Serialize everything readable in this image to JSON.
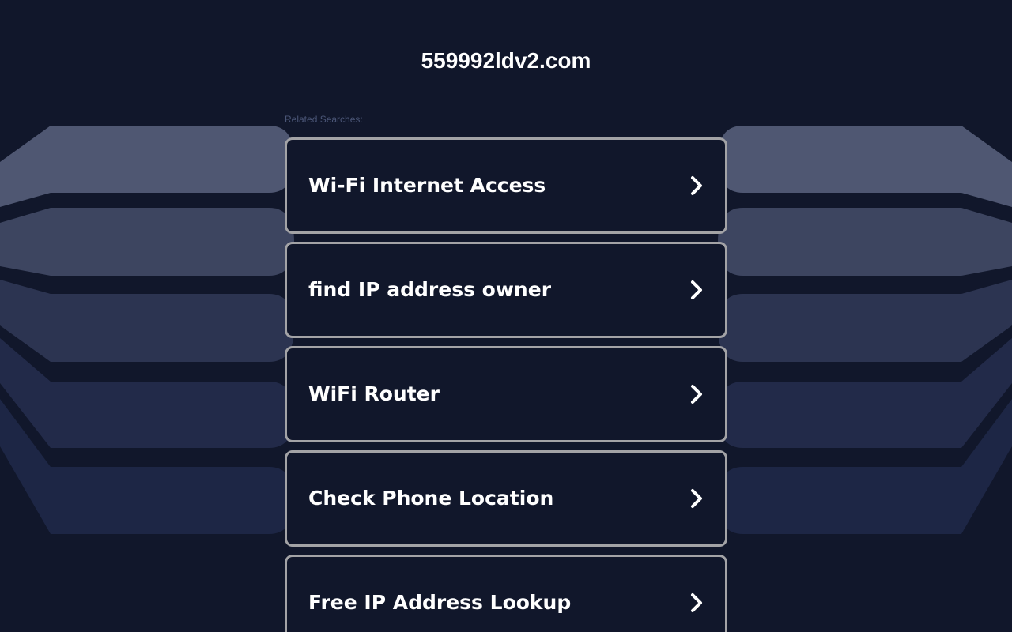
{
  "header": {
    "site_title": "559992ldv2.com"
  },
  "related": {
    "label": "Related Searches:",
    "items": [
      {
        "label": "Wi-Fi Internet Access",
        "icon": "chevron-right-icon"
      },
      {
        "label": "find IP address owner",
        "icon": "chevron-right-icon"
      },
      {
        "label": "WiFi Router",
        "icon": "chevron-right-icon"
      },
      {
        "label": "Check Phone Location",
        "icon": "chevron-right-icon"
      },
      {
        "label": "Free IP Address Lookup",
        "icon": "chevron-right-icon"
      }
    ]
  },
  "colors": {
    "background": "#11172b",
    "card_border": "#a3a3a6",
    "band_1": "#4f5772",
    "band_2": "#3d4560",
    "band_3": "#2c3451",
    "band_4": "#222a49",
    "band_5": "#1d2645"
  }
}
